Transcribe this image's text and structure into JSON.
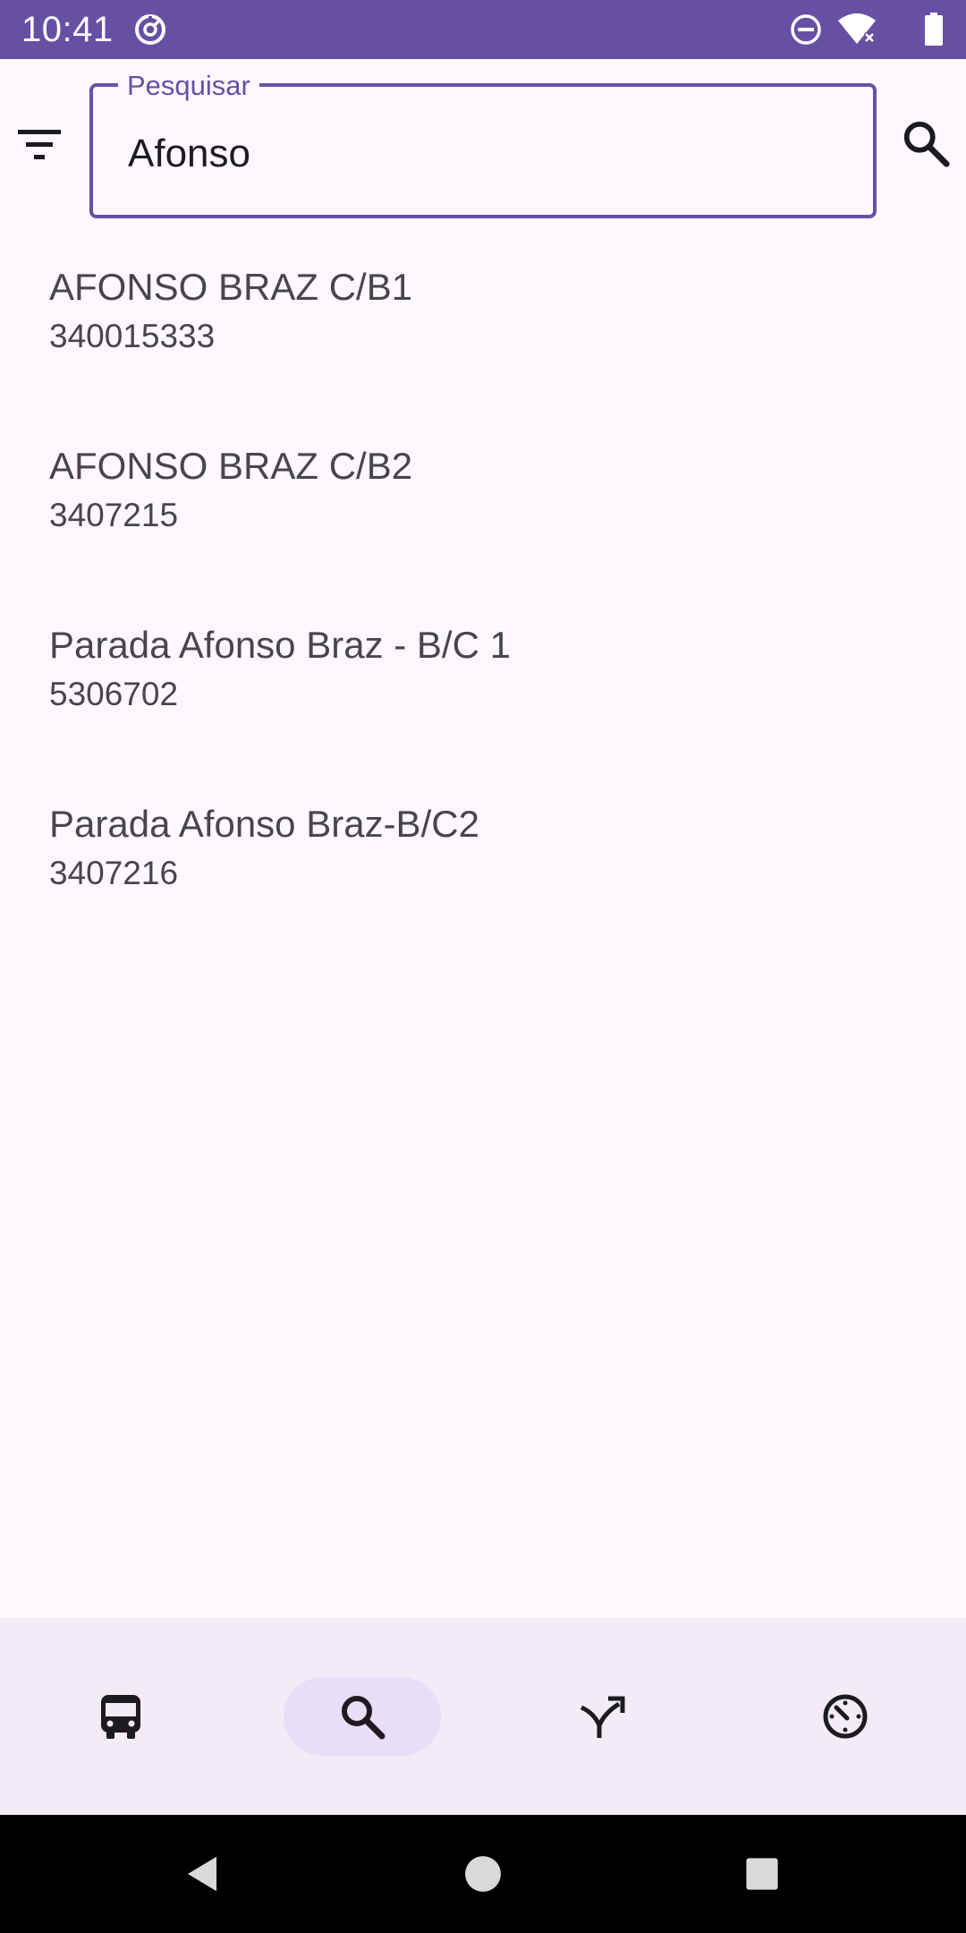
{
  "status_bar": {
    "time": "10:41",
    "left_icons": [
      "data-saver-icon"
    ],
    "right_icons": [
      "do-not-disturb-icon",
      "wifi-icon",
      "battery-icon"
    ],
    "color": "#6750a4"
  },
  "search": {
    "label": "Pesquisar",
    "value": "Afonso",
    "accent_color": "#6750a4"
  },
  "results": [
    {
      "name": "AFONSO BRAZ C/B1",
      "code": "340015333"
    },
    {
      "name": "AFONSO BRAZ C/B2",
      "code": "3407215"
    },
    {
      "name": "Parada Afonso Braz - B/C 1",
      "code": "5306702"
    },
    {
      "name": "Parada Afonso Braz-B/C2",
      "code": "3407216"
    }
  ],
  "bottom_nav": {
    "items": [
      {
        "icon": "bus-icon",
        "active": false
      },
      {
        "icon": "search-icon",
        "active": true
      },
      {
        "icon": "route-merge-icon",
        "active": false
      },
      {
        "icon": "timer-icon",
        "active": false
      }
    ],
    "background": "#f1ecf5",
    "active_indicator": "#e8def8"
  },
  "system_nav": {
    "buttons": [
      "back-icon",
      "home-icon",
      "recents-icon"
    ]
  }
}
